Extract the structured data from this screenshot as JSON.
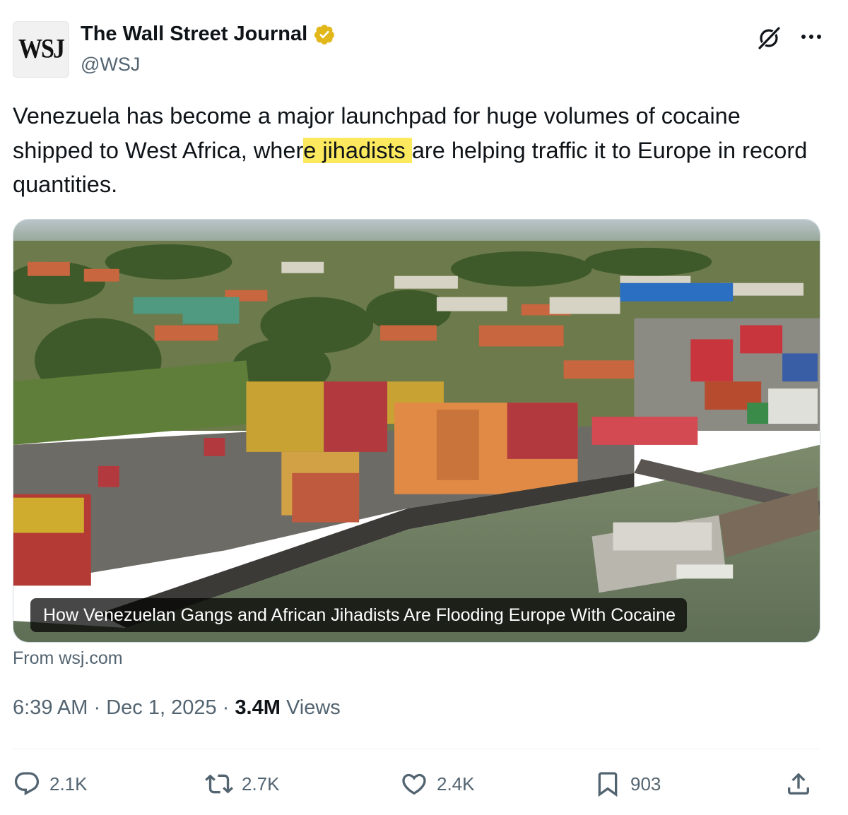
{
  "account": {
    "avatar_text": "WSJ",
    "name": "The Wall Street Journal",
    "handle": "@WSJ"
  },
  "tweet": {
    "text_before": "Venezuela has become a major launchpad for huge volumes of cocaine shipped to West Africa, wher",
    "text_highlight": "e jihadists ",
    "text_after": "are helping traffic it to Europe in record quantities."
  },
  "card": {
    "caption": "How Venezuelan Gangs and African Jihadists Are Flooding Europe With Cocaine",
    "source": "From wsj.com"
  },
  "meta": {
    "time": "6:39 AM",
    "separator": "·",
    "date": "Dec 1, 2025",
    "views_count": "3.4M",
    "views_label": "Views"
  },
  "actions": {
    "replies": "2.1K",
    "reposts": "2.7K",
    "likes": "2.4K",
    "bookmarks": "903"
  },
  "icons": [
    "verified-badge-icon",
    "grok-icon",
    "more-icon",
    "reply-icon",
    "repost-icon",
    "like-icon",
    "bookmark-icon",
    "share-icon"
  ],
  "colors": {
    "verified_gold": "#e2b719",
    "highlight": "#fde95e",
    "secondary_text": "#536471"
  }
}
